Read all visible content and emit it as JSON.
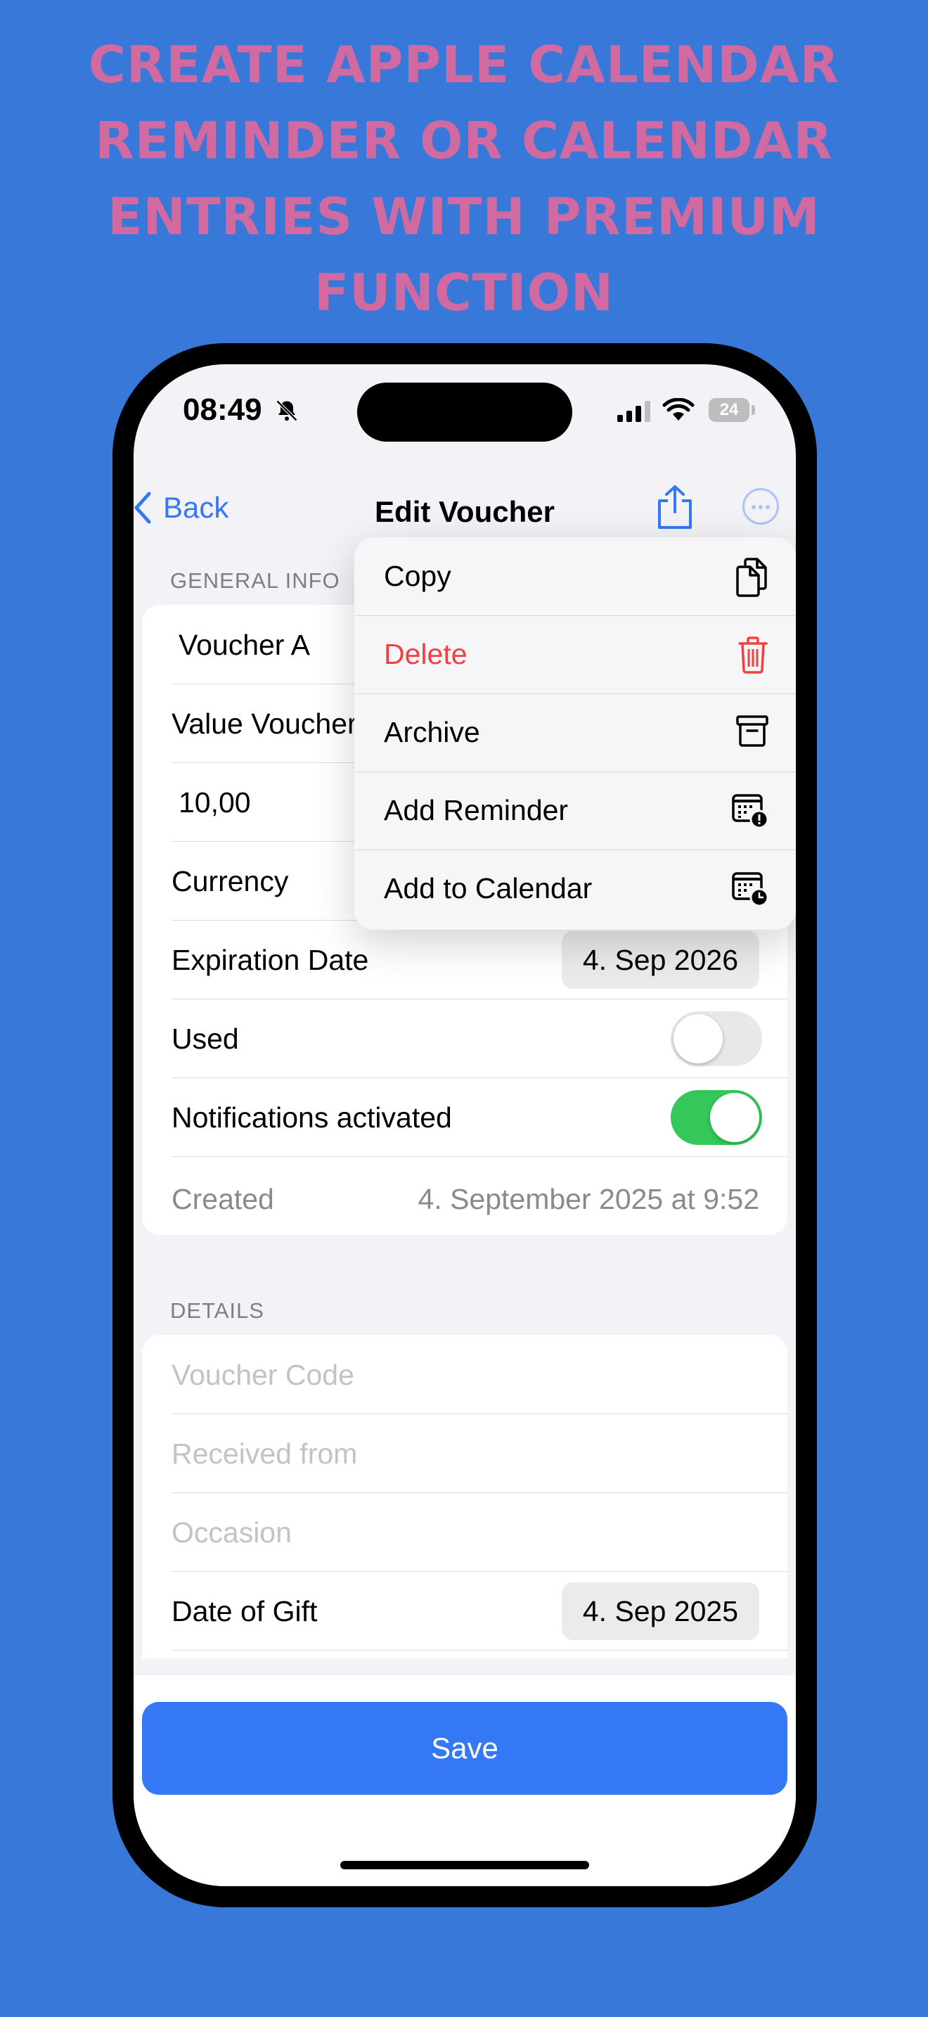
{
  "promo": {
    "headline": "CREATE APPLE CALENDAR REMINDER OR CALENDAR ENTRIES WITH PREMIUM FUNCTION"
  },
  "status_bar": {
    "time": "08:49",
    "battery": "24",
    "icons": [
      "bell-slash-icon",
      "signal-icon",
      "wifi-icon",
      "battery-icon"
    ]
  },
  "nav": {
    "back_label": "Back",
    "title": "Edit Voucher",
    "icons": [
      "chevron-left-icon",
      "share-icon",
      "more-icon"
    ]
  },
  "general": {
    "header": "GENERAL INFO",
    "name": "Voucher A",
    "type": "Value Voucher",
    "amount": "10,00",
    "currency_label": "Currency",
    "expiration_label": "Expiration Date",
    "expiration_value": "4. Sep 2026",
    "used_label": "Used",
    "used_on": false,
    "notifications_label": "Notifications activated",
    "notifications_on": true,
    "created_label": "Created",
    "created_value": "4. September 2025 at 9:52"
  },
  "details": {
    "header": "DETAILS",
    "code_placeholder": "Voucher Code",
    "received_placeholder": "Received from",
    "occasion_placeholder": "Occasion",
    "gift_date_label": "Date of Gift",
    "gift_date_value": "4. Sep 2025"
  },
  "menu": {
    "items": [
      {
        "label": "Copy",
        "icon": "copy-icon"
      },
      {
        "label": "Delete",
        "icon": "trash-icon",
        "color": "#F2413C"
      },
      {
        "label": "Archive",
        "icon": "archive-icon"
      },
      {
        "label": "Add Reminder",
        "icon": "calendar-alert-icon"
      },
      {
        "label": "Add to Calendar",
        "icon": "calendar-clock-icon"
      }
    ]
  },
  "save_label": "Save",
  "colors": {
    "background": "#3878D8",
    "headline": "#D06AA0",
    "accent": "#3478F6",
    "danger": "#F2413C",
    "toggle_on": "#34C759"
  }
}
